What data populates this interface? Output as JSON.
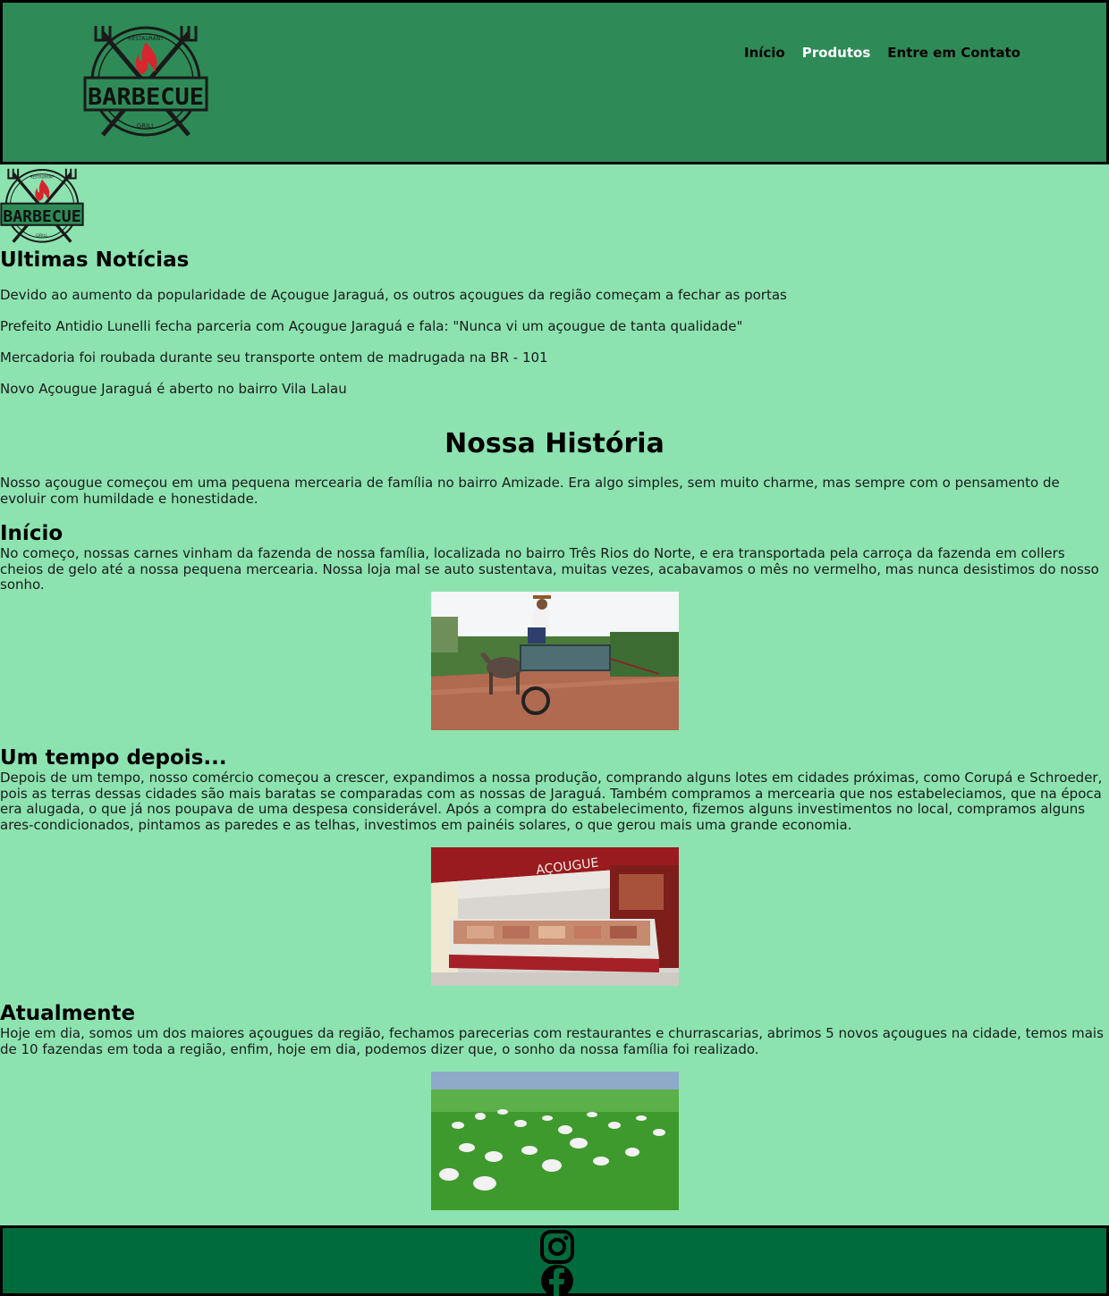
{
  "logo": {
    "top_text": "RESTAURANT",
    "main_text": "BARBECUE",
    "bottom_text": "GRILL"
  },
  "nav": {
    "items": [
      "Início",
      "Produtos",
      "Entre em Contato"
    ],
    "active_index": 1
  },
  "news": {
    "title": "Ultimas Notícias",
    "items": [
      "Devido ao aumento da popularidade de Açougue Jaraguá, os outros açougues da região começam a fechar as portas",
      "Prefeito Antidio Lunelli fecha parceria com Açougue Jaraguá e fala: \"Nunca vi um açougue de tanta qualidade\"",
      "Mercadoria foi roubada durante seu transporte ontem de madrugada na BR - 101",
      "Novo Açougue Jaraguá é aberto no bairro Vila Lalau"
    ]
  },
  "history": {
    "title": "Nossa História",
    "intro": "Nosso açougue começou em uma pequena mercearia de família no bairro Amizade. Era algo simples, sem muito charme, mas sempre com o pensamento de evoluir com humildade e honestidade.",
    "sections": [
      {
        "title": "Início",
        "text": "No começo, nossas carnes vinham da fazenda de nossa família, localizada no bairro Três Rios do Norte, e era transportada pela carroça da fazenda em collers cheios de gelo até a nossa pequena mercearia. Nossa loja mal se auto sustentava, muitas vezes, acabavamos o mês no vermelho, mas nunca desistimos do nosso sonho."
      },
      {
        "title": "Um tempo depois...",
        "text": "Depois de um tempo, nosso comércio começou a crescer, expandimos a nossa produção, comprando alguns lotes em cidades próximas, como Corupá e Schroeder, pois as terras dessas cidades são mais baratas se comparadas com as nossas de Jaraguá. Também compramos a mercearia que nos estabeleciamos, que na época era alugada, o que já nos poupava de uma despesa considerável. Após a compra do estabelecimento, fizemos alguns investimentos no local, compramos alguns ares-condicionados, pintamos as paredes e as telhas, investimos em painéis solares, o que gerou mais uma grande economia."
      },
      {
        "title": "Atualmente",
        "text": "Hoje em dia, somos um dos maiores açougues da região, fechamos parecerias com restaurantes e churrascarias, abrimos 5 novos açougues na cidade, temos mais de 10 fazendas em toda a região, enfim, hoje em dia, podemos dizer que, o sonho da nossa família foi realizado."
      }
    ],
    "photo_sign": "AÇOUGUE"
  },
  "footer": {
    "icons": [
      "instagram-icon",
      "facebook-icon"
    ]
  },
  "colors": {
    "header_bg": "#2e8b57",
    "body_bg": "#8ce3b0",
    "footer_bg": "#006b3c",
    "nav_active": "#ffffff"
  }
}
